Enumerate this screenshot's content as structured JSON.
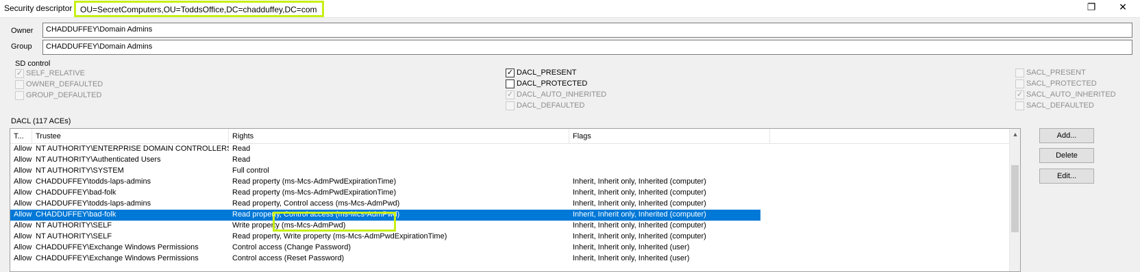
{
  "window": {
    "title_label": "Security descriptor",
    "dn": "OU=SecretComputers,OU=ToddsOffice,DC=chadduffey,DC=com",
    "restore_glyph": "❐",
    "close_glyph": "✕"
  },
  "owner": {
    "label": "Owner",
    "value": "CHADDUFFEY\\Domain Admins"
  },
  "group": {
    "label": "Group",
    "value": "CHADDUFFEY\\Domain Admins"
  },
  "sd_control": {
    "label": "SD control",
    "flags": [
      {
        "name": "SELF_RELATIVE",
        "checked": true,
        "enabled": false
      },
      {
        "name": "OWNER_DEFAULTED",
        "checked": false,
        "enabled": false
      },
      {
        "name": "GROUP_DEFAULTED",
        "checked": false,
        "enabled": false
      },
      {
        "name": "DACL_PRESENT",
        "checked": true,
        "enabled": true
      },
      {
        "name": "DACL_PROTECTED",
        "checked": false,
        "enabled": true
      },
      {
        "name": "DACL_AUTO_INHERITED",
        "checked": true,
        "enabled": false
      },
      {
        "name": "DACL_DEFAULTED",
        "checked": false,
        "enabled": false
      },
      {
        "name": "SACL_PRESENT",
        "checked": false,
        "enabled": false
      },
      {
        "name": "SACL_PROTECTED",
        "checked": false,
        "enabled": false
      },
      {
        "name": "SACL_AUTO_INHERITED",
        "checked": true,
        "enabled": false
      },
      {
        "name": "SACL_DEFAULTED",
        "checked": false,
        "enabled": false
      }
    ]
  },
  "dacl": {
    "label": "DACL (117 ACEs)",
    "columns": [
      "T...",
      "Trustee",
      "Rights",
      "Flags"
    ],
    "rows": [
      {
        "type": "Allow",
        "trustee": "NT AUTHORITY\\ENTERPRISE DOMAIN CONTROLLERS",
        "rights": "Read",
        "flags": ""
      },
      {
        "type": "Allow",
        "trustee": "NT AUTHORITY\\Authenticated Users",
        "rights": "Read",
        "flags": ""
      },
      {
        "type": "Allow",
        "trustee": "NT AUTHORITY\\SYSTEM",
        "rights": "Full control",
        "flags": ""
      },
      {
        "type": "Allow",
        "trustee": "CHADDUFFEY\\todds-laps-admins",
        "rights": "Read property (ms-Mcs-AdmPwdExpirationTime)",
        "flags": "Inherit, Inherit only, Inherited (computer)"
      },
      {
        "type": "Allow",
        "trustee": "CHADDUFFEY\\bad-folk",
        "rights": "Read property (ms-Mcs-AdmPwdExpirationTime)",
        "flags": "Inherit, Inherit only, Inherited (computer)"
      },
      {
        "type": "Allow",
        "trustee": "CHADDUFFEY\\todds-laps-admins",
        "rights": "Read property, Control access (ms-Mcs-AdmPwd)",
        "flags": "Inherit, Inherit only, Inherited (computer)"
      },
      {
        "type": "Allow",
        "trustee": "CHADDUFFEY\\bad-folk",
        "rights": "Read property, Control access (ms-Mcs-AdmPwd)",
        "flags": "Inherit, Inherit only, Inherited (computer)"
      },
      {
        "type": "Allow",
        "trustee": "NT AUTHORITY\\SELF",
        "rights": "Write property (ms-Mcs-AdmPwd)",
        "flags": "Inherit, Inherit only, Inherited (computer)"
      },
      {
        "type": "Allow",
        "trustee": "NT AUTHORITY\\SELF",
        "rights": "Read property, Write property (ms-Mcs-AdmPwdExpirationTime)",
        "flags": "Inherit, Inherit only, Inherited (computer)"
      },
      {
        "type": "Allow",
        "trustee": "CHADDUFFEY\\Exchange Windows Permissions",
        "rights": "Control access (Change Password)",
        "flags": "Inherit, Inherit only, Inherited (user)"
      },
      {
        "type": "Allow",
        "trustee": "CHADDUFFEY\\Exchange Windows Permissions",
        "rights": "Control access (Reset Password)",
        "flags": "Inherit, Inherit only, Inherited (user)"
      }
    ],
    "selected_index": 6
  },
  "buttons": {
    "add": "Add...",
    "delete": "Delete",
    "edit": "Edit..."
  },
  "highlight_color": "#c6f014",
  "selection_color": "#0078d7"
}
